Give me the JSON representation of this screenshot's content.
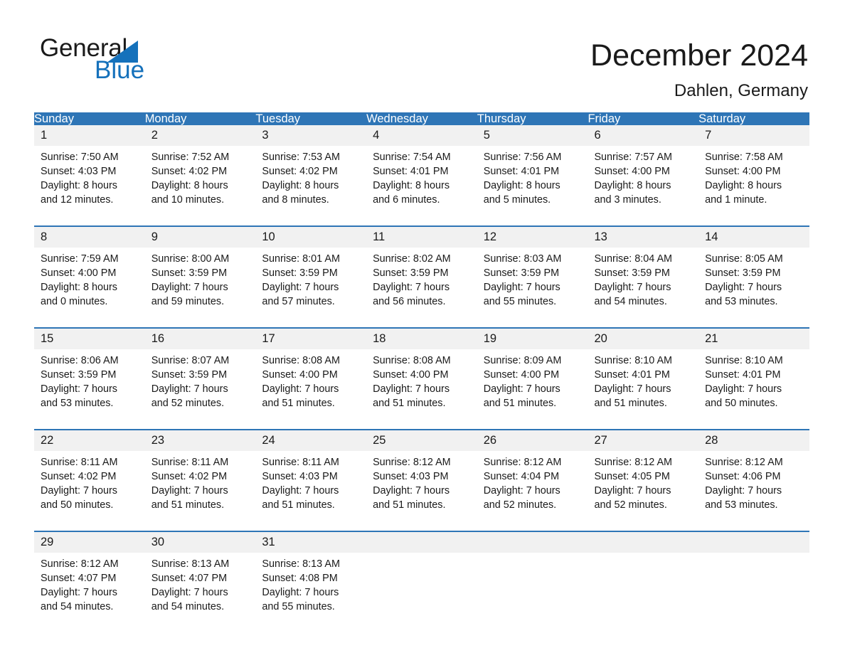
{
  "brand": {
    "name_part1": "General",
    "name_part2": "Blue",
    "triangle_color": "#1571bb",
    "text_color": "#1a1a1a"
  },
  "header": {
    "title": "December 2024",
    "location": "Dahlen, Germany"
  },
  "theme": {
    "header_blue": "#2e75b6",
    "day_band_gray": "#f1f1f1",
    "cell_white": "#ffffff",
    "text_color": "#1a1a1a"
  },
  "weekday_headers": [
    "Sunday",
    "Monday",
    "Tuesday",
    "Wednesday",
    "Thursday",
    "Friday",
    "Saturday"
  ],
  "weeks": [
    {
      "days": [
        {
          "number": "1",
          "sunrise": "Sunrise: 7:50 AM",
          "sunset": "Sunset: 4:03 PM",
          "daylight_line1": "Daylight: 8 hours",
          "daylight_line2": "and 12 minutes."
        },
        {
          "number": "2",
          "sunrise": "Sunrise: 7:52 AM",
          "sunset": "Sunset: 4:02 PM",
          "daylight_line1": "Daylight: 8 hours",
          "daylight_line2": "and 10 minutes."
        },
        {
          "number": "3",
          "sunrise": "Sunrise: 7:53 AM",
          "sunset": "Sunset: 4:02 PM",
          "daylight_line1": "Daylight: 8 hours",
          "daylight_line2": "and 8 minutes."
        },
        {
          "number": "4",
          "sunrise": "Sunrise: 7:54 AM",
          "sunset": "Sunset: 4:01 PM",
          "daylight_line1": "Daylight: 8 hours",
          "daylight_line2": "and 6 minutes."
        },
        {
          "number": "5",
          "sunrise": "Sunrise: 7:56 AM",
          "sunset": "Sunset: 4:01 PM",
          "daylight_line1": "Daylight: 8 hours",
          "daylight_line2": "and 5 minutes."
        },
        {
          "number": "6",
          "sunrise": "Sunrise: 7:57 AM",
          "sunset": "Sunset: 4:00 PM",
          "daylight_line1": "Daylight: 8 hours",
          "daylight_line2": "and 3 minutes."
        },
        {
          "number": "7",
          "sunrise": "Sunrise: 7:58 AM",
          "sunset": "Sunset: 4:00 PM",
          "daylight_line1": "Daylight: 8 hours",
          "daylight_line2": "and 1 minute."
        }
      ]
    },
    {
      "days": [
        {
          "number": "8",
          "sunrise": "Sunrise: 7:59 AM",
          "sunset": "Sunset: 4:00 PM",
          "daylight_line1": "Daylight: 8 hours",
          "daylight_line2": "and 0 minutes."
        },
        {
          "number": "9",
          "sunrise": "Sunrise: 8:00 AM",
          "sunset": "Sunset: 3:59 PM",
          "daylight_line1": "Daylight: 7 hours",
          "daylight_line2": "and 59 minutes."
        },
        {
          "number": "10",
          "sunrise": "Sunrise: 8:01 AM",
          "sunset": "Sunset: 3:59 PM",
          "daylight_line1": "Daylight: 7 hours",
          "daylight_line2": "and 57 minutes."
        },
        {
          "number": "11",
          "sunrise": "Sunrise: 8:02 AM",
          "sunset": "Sunset: 3:59 PM",
          "daylight_line1": "Daylight: 7 hours",
          "daylight_line2": "and 56 minutes."
        },
        {
          "number": "12",
          "sunrise": "Sunrise: 8:03 AM",
          "sunset": "Sunset: 3:59 PM",
          "daylight_line1": "Daylight: 7 hours",
          "daylight_line2": "and 55 minutes."
        },
        {
          "number": "13",
          "sunrise": "Sunrise: 8:04 AM",
          "sunset": "Sunset: 3:59 PM",
          "daylight_line1": "Daylight: 7 hours",
          "daylight_line2": "and 54 minutes."
        },
        {
          "number": "14",
          "sunrise": "Sunrise: 8:05 AM",
          "sunset": "Sunset: 3:59 PM",
          "daylight_line1": "Daylight: 7 hours",
          "daylight_line2": "and 53 minutes."
        }
      ]
    },
    {
      "days": [
        {
          "number": "15",
          "sunrise": "Sunrise: 8:06 AM",
          "sunset": "Sunset: 3:59 PM",
          "daylight_line1": "Daylight: 7 hours",
          "daylight_line2": "and 53 minutes."
        },
        {
          "number": "16",
          "sunrise": "Sunrise: 8:07 AM",
          "sunset": "Sunset: 3:59 PM",
          "daylight_line1": "Daylight: 7 hours",
          "daylight_line2": "and 52 minutes."
        },
        {
          "number": "17",
          "sunrise": "Sunrise: 8:08 AM",
          "sunset": "Sunset: 4:00 PM",
          "daylight_line1": "Daylight: 7 hours",
          "daylight_line2": "and 51 minutes."
        },
        {
          "number": "18",
          "sunrise": "Sunrise: 8:08 AM",
          "sunset": "Sunset: 4:00 PM",
          "daylight_line1": "Daylight: 7 hours",
          "daylight_line2": "and 51 minutes."
        },
        {
          "number": "19",
          "sunrise": "Sunrise: 8:09 AM",
          "sunset": "Sunset: 4:00 PM",
          "daylight_line1": "Daylight: 7 hours",
          "daylight_line2": "and 51 minutes."
        },
        {
          "number": "20",
          "sunrise": "Sunrise: 8:10 AM",
          "sunset": "Sunset: 4:01 PM",
          "daylight_line1": "Daylight: 7 hours",
          "daylight_line2": "and 51 minutes."
        },
        {
          "number": "21",
          "sunrise": "Sunrise: 8:10 AM",
          "sunset": "Sunset: 4:01 PM",
          "daylight_line1": "Daylight: 7 hours",
          "daylight_line2": "and 50 minutes."
        }
      ]
    },
    {
      "days": [
        {
          "number": "22",
          "sunrise": "Sunrise: 8:11 AM",
          "sunset": "Sunset: 4:02 PM",
          "daylight_line1": "Daylight: 7 hours",
          "daylight_line2": "and 50 minutes."
        },
        {
          "number": "23",
          "sunrise": "Sunrise: 8:11 AM",
          "sunset": "Sunset: 4:02 PM",
          "daylight_line1": "Daylight: 7 hours",
          "daylight_line2": "and 51 minutes."
        },
        {
          "number": "24",
          "sunrise": "Sunrise: 8:11 AM",
          "sunset": "Sunset: 4:03 PM",
          "daylight_line1": "Daylight: 7 hours",
          "daylight_line2": "and 51 minutes."
        },
        {
          "number": "25",
          "sunrise": "Sunrise: 8:12 AM",
          "sunset": "Sunset: 4:03 PM",
          "daylight_line1": "Daylight: 7 hours",
          "daylight_line2": "and 51 minutes."
        },
        {
          "number": "26",
          "sunrise": "Sunrise: 8:12 AM",
          "sunset": "Sunset: 4:04 PM",
          "daylight_line1": "Daylight: 7 hours",
          "daylight_line2": "and 52 minutes."
        },
        {
          "number": "27",
          "sunrise": "Sunrise: 8:12 AM",
          "sunset": "Sunset: 4:05 PM",
          "daylight_line1": "Daylight: 7 hours",
          "daylight_line2": "and 52 minutes."
        },
        {
          "number": "28",
          "sunrise": "Sunrise: 8:12 AM",
          "sunset": "Sunset: 4:06 PM",
          "daylight_line1": "Daylight: 7 hours",
          "daylight_line2": "and 53 minutes."
        }
      ]
    },
    {
      "days": [
        {
          "number": "29",
          "sunrise": "Sunrise: 8:12 AM",
          "sunset": "Sunset: 4:07 PM",
          "daylight_line1": "Daylight: 7 hours",
          "daylight_line2": "and 54 minutes."
        },
        {
          "number": "30",
          "sunrise": "Sunrise: 8:13 AM",
          "sunset": "Sunset: 4:07 PM",
          "daylight_line1": "Daylight: 7 hours",
          "daylight_line2": "and 54 minutes."
        },
        {
          "number": "31",
          "sunrise": "Sunrise: 8:13 AM",
          "sunset": "Sunset: 4:08 PM",
          "daylight_line1": "Daylight: 7 hours",
          "daylight_line2": "and 55 minutes."
        },
        {
          "number": "",
          "sunrise": "",
          "sunset": "",
          "daylight_line1": "",
          "daylight_line2": ""
        },
        {
          "number": "",
          "sunrise": "",
          "sunset": "",
          "daylight_line1": "",
          "daylight_line2": ""
        },
        {
          "number": "",
          "sunrise": "",
          "sunset": "",
          "daylight_line1": "",
          "daylight_line2": ""
        },
        {
          "number": "",
          "sunrise": "",
          "sunset": "",
          "daylight_line1": "",
          "daylight_line2": ""
        }
      ]
    }
  ]
}
